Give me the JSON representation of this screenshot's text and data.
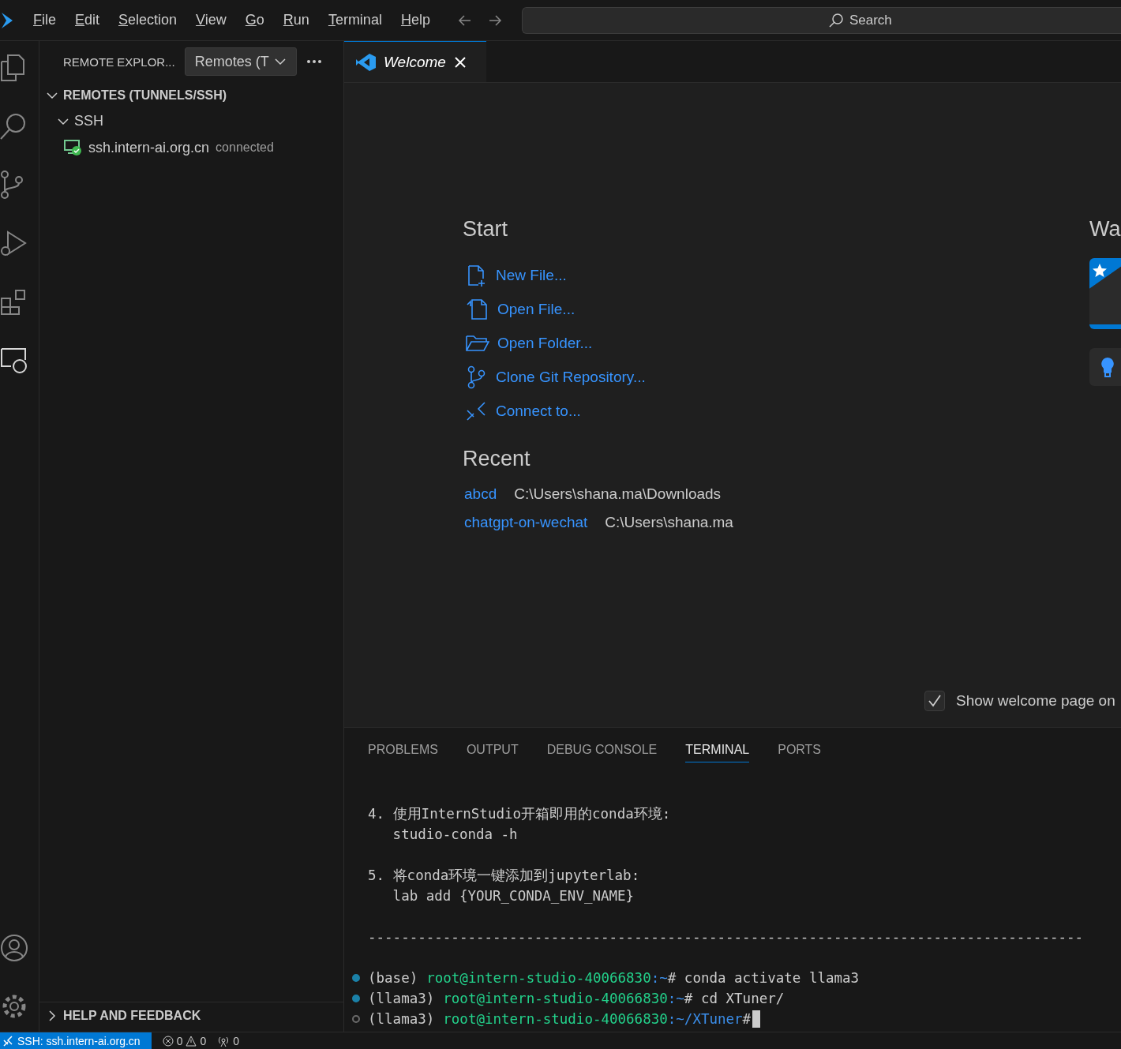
{
  "menu": [
    {
      "label": "File"
    },
    {
      "label": "Edit"
    },
    {
      "label": "Selection"
    },
    {
      "label": "View"
    },
    {
      "label": "Go"
    },
    {
      "label": "Run"
    },
    {
      "label": "Terminal"
    },
    {
      "label": "Help"
    }
  ],
  "search": {
    "placeholder": "Search"
  },
  "sidebar": {
    "title": "REMOTE EXPLOR...",
    "dropdown": "Remotes (T",
    "sections": [
      {
        "label": "REMOTES (TUNNELS/SSH)",
        "expanded": true,
        "children": [
          {
            "label": "SSH",
            "expanded": true,
            "children": [
              {
                "label": "ssh.intern-ai.org.cn",
                "status": "connected"
              }
            ]
          }
        ]
      }
    ],
    "footer_section": {
      "label": "HELP AND FEEDBACK",
      "expanded": false
    }
  },
  "tabs": [
    {
      "label": "Welcome",
      "selected": true
    }
  ],
  "welcome": {
    "start_title": "Start",
    "start_items": [
      {
        "kind": "new-file",
        "label": "New File..."
      },
      {
        "kind": "open-file",
        "label": "Open File..."
      },
      {
        "kind": "open-folder",
        "label": "Open Folder..."
      },
      {
        "kind": "clone",
        "label": "Clone Git Repository..."
      },
      {
        "kind": "connect",
        "label": "Connect to..."
      }
    ],
    "recent_title": "Recent",
    "recent_items": [
      {
        "name": "abcd",
        "path": "C:\\Users\\shana.ma\\Downloads"
      },
      {
        "name": "chatgpt-on-wechat",
        "path": "C:\\Users\\shana.ma"
      }
    ],
    "walkthroughs_title": "Wa",
    "show_on_startup": {
      "label": "Show welcome page on",
      "checked": true
    }
  },
  "panel_tabs": [
    {
      "label": "PROBLEMS",
      "selected": false
    },
    {
      "label": "OUTPUT",
      "selected": false
    },
    {
      "label": "DEBUG CONSOLE",
      "selected": false
    },
    {
      "label": "TERMINAL",
      "selected": true
    },
    {
      "label": "PORTS",
      "selected": false
    }
  ],
  "terminal": [
    {
      "kind": "text",
      "text": "4. 使用InternStudio开箱即用的conda环境:"
    },
    {
      "kind": "text",
      "text": "   studio-conda -h"
    },
    {
      "kind": "blank"
    },
    {
      "kind": "text",
      "text": "5. 将conda环境一键添加到jupyterlab:"
    },
    {
      "kind": "text",
      "text": "   lab add {YOUR_CONDA_ENV_NAME}"
    },
    {
      "kind": "blank"
    },
    {
      "kind": "text",
      "text": "--------------------------------------------------------------------------------------"
    },
    {
      "kind": "blank"
    },
    {
      "kind": "prompt",
      "done": true,
      "env": "(base)",
      "user": "root@intern-studio-40066830",
      "path": ":~",
      "command": "# conda activate llama3"
    },
    {
      "kind": "prompt",
      "done": true,
      "env": "(llama3)",
      "user": "root@intern-studio-40066830",
      "path": ":~",
      "command": "# cd XTuner/"
    },
    {
      "kind": "prompt",
      "done": false,
      "env": "(llama3)",
      "user": "root@intern-studio-40066830",
      "path": ":~/XTuner",
      "command": "#"
    }
  ],
  "status_bar": {
    "remote": "SSH: ssh.intern-ai.org.cn",
    "errors": "0",
    "warnings": "0",
    "ports": "0"
  }
}
